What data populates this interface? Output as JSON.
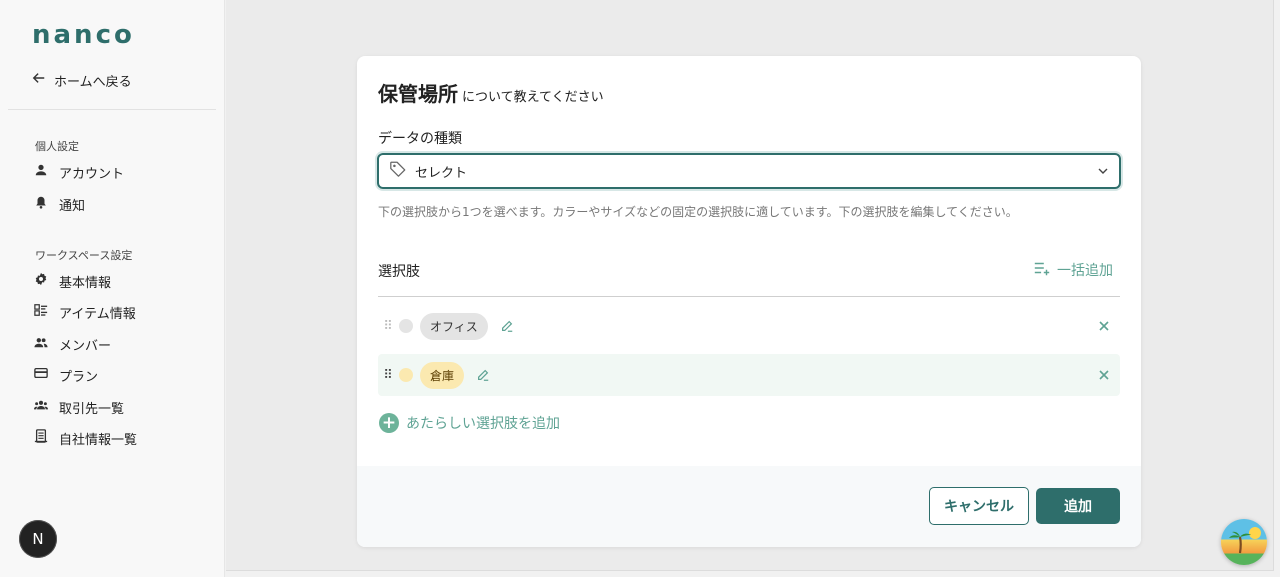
{
  "sidebar": {
    "logo": "nanco",
    "back_label": "ホームへ戻る",
    "personal_section": "個人設定",
    "personal_items": [
      {
        "label": "アカウント",
        "icon": "person-icon"
      },
      {
        "label": "通知",
        "icon": "bell-icon"
      }
    ],
    "workspace_section": "ワークスペース設定",
    "workspace_items": [
      {
        "label": "基本情報",
        "icon": "gear-icon"
      },
      {
        "label": "アイテム情報",
        "icon": "list-icon"
      },
      {
        "label": "メンバー",
        "icon": "group-icon"
      },
      {
        "label": "プラン",
        "icon": "card-icon"
      },
      {
        "label": "取引先一覧",
        "icon": "partners-icon"
      },
      {
        "label": "自社情報一覧",
        "icon": "document-icon"
      }
    ],
    "avatar_letter": "N"
  },
  "modal": {
    "title_strong": "保管場所",
    "title_rest": "について教えてください",
    "field_label": "データの種類",
    "select_value": "セレクト",
    "help_text": "下の選択肢から1つを選べます。カラーやサイズなどの固定の選択肢に適しています。下の選択肢を編集してください。",
    "options_label": "選択肢",
    "bulk_add_label": "一括追加",
    "options": [
      {
        "label": "オフィス",
        "dot_color": "#e4e4e4",
        "chip_bg": "#e4e4e4",
        "chip_text": "#333333"
      },
      {
        "label": "倉庫",
        "dot_color": "#fbe9b0",
        "chip_bg": "#fbe9b0",
        "chip_text": "#5a3d00"
      }
    ],
    "add_option_label": "あたらしい選択肢を追加",
    "cancel_label": "キャンセル",
    "submit_label": "追加"
  },
  "colors": {
    "brand": "#2e6e6b",
    "accent_light": "#5fa394"
  }
}
